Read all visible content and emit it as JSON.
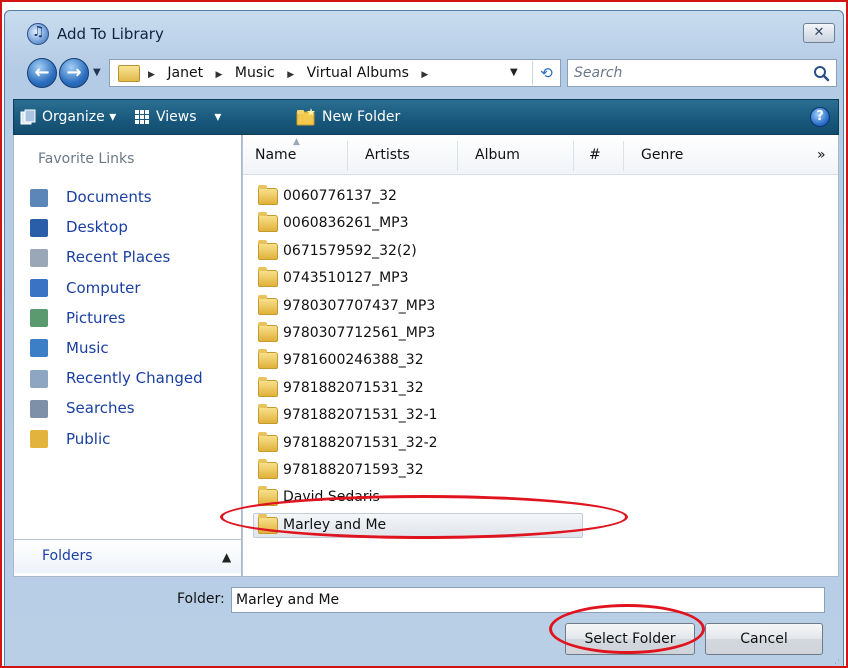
{
  "window": {
    "title": "Add To Library",
    "close_label": "⊠"
  },
  "nav": {
    "breadcrumbs": [
      "Janet",
      "Music",
      "Virtual Albums"
    ],
    "search_placeholder": "Search"
  },
  "toolbar": {
    "organize": "Organize",
    "views": "Views",
    "new_folder": "New Folder",
    "help": "?"
  },
  "sidebar": {
    "title": "Favorite Links",
    "items": [
      {
        "label": "Documents",
        "icon": "documents-icon",
        "color": "#5c86b8"
      },
      {
        "label": "Desktop",
        "icon": "desktop-icon",
        "color": "#2b5ea8"
      },
      {
        "label": "Recent Places",
        "icon": "recent-places-icon",
        "color": "#9aa7b6"
      },
      {
        "label": "Computer",
        "icon": "computer-icon",
        "color": "#3a73c4"
      },
      {
        "label": "Pictures",
        "icon": "pictures-icon",
        "color": "#5b9a6f"
      },
      {
        "label": "Music",
        "icon": "music-icon",
        "color": "#3c7fc7"
      },
      {
        "label": "Recently Changed",
        "icon": "recently-changed-icon",
        "color": "#8fa6c2"
      },
      {
        "label": "Searches",
        "icon": "searches-icon",
        "color": "#7d90a8"
      },
      {
        "label": "Public",
        "icon": "public-folder-icon",
        "color": "#e2b43e"
      }
    ],
    "folders_label": "Folders",
    "folders_chevron": "⌃"
  },
  "columns": [
    "Name",
    "Artists",
    "Album",
    "#",
    "Genre"
  ],
  "more_columns": "»",
  "files": [
    "0060776137_32",
    "0060836261_MP3",
    "0671579592_32(2)",
    "0743510127_MP3",
    "9780307707437_MP3",
    "9780307712561_MP3",
    "9781600246388_32",
    "9781882071531_32",
    "9781882071531_32-1",
    "9781882071531_32-2",
    "9781882071593_32",
    "David Sedaris",
    "Marley and Me"
  ],
  "selected_file_index": 12,
  "folder_field": {
    "label": "Folder:",
    "value": "Marley and Me"
  },
  "buttons": {
    "select": "Select Folder",
    "cancel": "Cancel"
  },
  "colors": {
    "annotation": "#e0141e",
    "toolbar": "#195a7e",
    "link": "#1a3fa0"
  }
}
